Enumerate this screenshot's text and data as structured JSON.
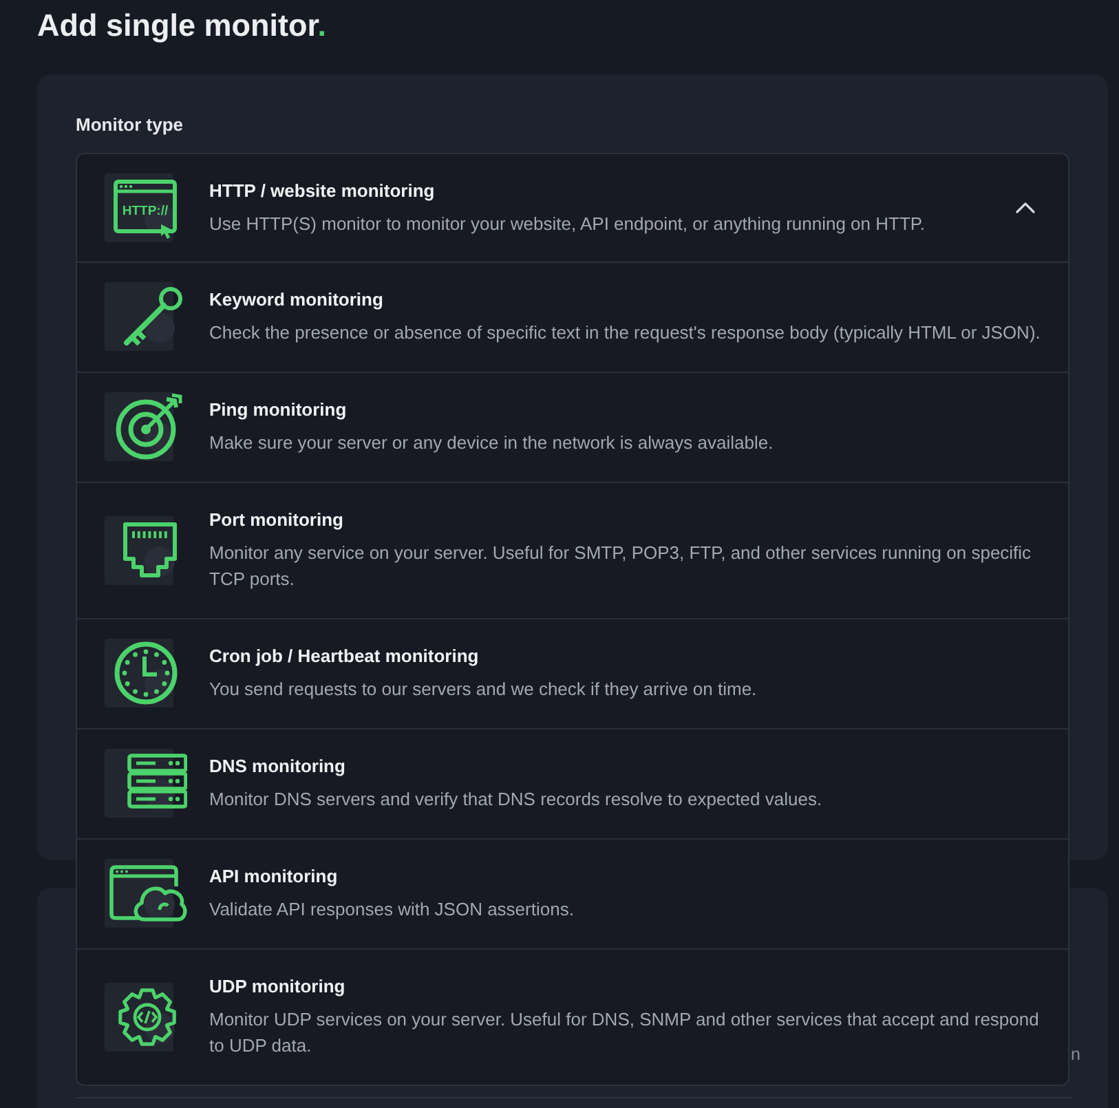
{
  "page": {
    "title": "Add single monitor",
    "title_accent": "."
  },
  "monitor_type": {
    "label": "Monitor type",
    "expanded": true,
    "value": {
      "kind": "http",
      "icon_text": "HTTP://",
      "title": "HTTP / website monitoring",
      "description": "Use HTTP(S) monitor to monitor your website, API endpoint, or anything running on HTTP."
    },
    "options": [
      {
        "kind": "keyword",
        "title": "Keyword monitoring",
        "description": "Check the presence or absence of specific text in the request's response body (typically HTML or JSON)."
      },
      {
        "kind": "ping",
        "title": "Ping monitoring",
        "description": "Make sure your server or any device in the network is always available."
      },
      {
        "kind": "port",
        "title": "Port monitoring",
        "description": "Monitor any service on your server. Useful for SMTP, POP3, FTP, and other services running on specific TCP ports."
      },
      {
        "kind": "cron",
        "title": "Cron job / Heartbeat monitoring",
        "description": "You send requests to our servers and we check if they arrive on time."
      },
      {
        "kind": "dns",
        "title": "DNS monitoring",
        "description": "Monitor DNS servers and verify that DNS records resolve to expected values."
      },
      {
        "kind": "api",
        "title": "API monitoring",
        "description": "Validate API responses with JSON assertions."
      },
      {
        "kind": "udp",
        "title": "UDP monitoring",
        "description": "Monitor UDP services on your server. Useful for DNS, SNMP and other services that accept and respond to UDP data."
      }
    ]
  },
  "second_card": {
    "text": "n"
  }
}
